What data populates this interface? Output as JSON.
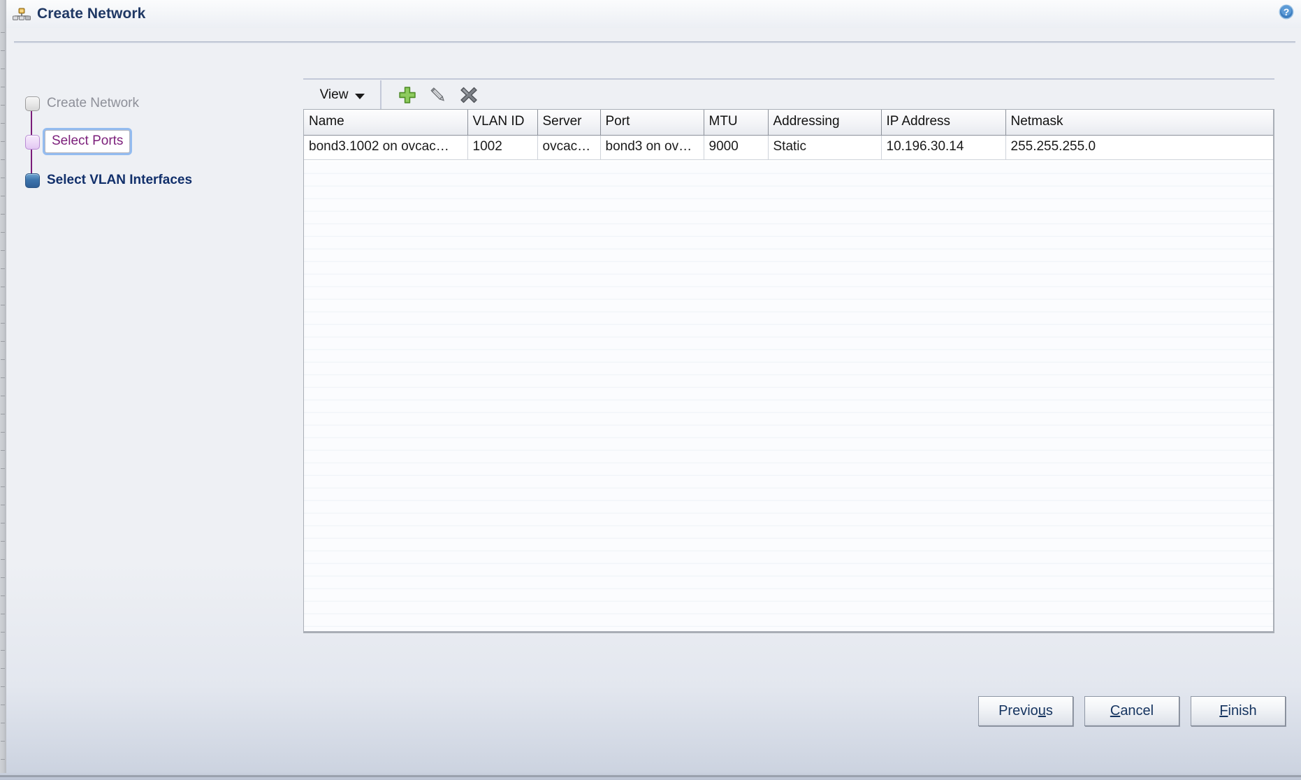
{
  "window": {
    "title": "Create Network",
    "title_icon": "network-create-icon",
    "help_icon": "help-question-icon"
  },
  "steps": [
    {
      "label": "Create Network",
      "state": "done",
      "icon": "step-box-done-icon"
    },
    {
      "label": "Select Ports",
      "state": "current",
      "icon": "step-box-current-icon"
    },
    {
      "label": "Select VLAN Interfaces",
      "state": "next",
      "icon": "step-box-next-icon"
    }
  ],
  "toolbar": {
    "view_label": "View",
    "caret_icon": "chevron-down-icon",
    "actions": [
      {
        "name": "add-icon",
        "label": "Add"
      },
      {
        "name": "edit-icon",
        "label": "Edit"
      },
      {
        "name": "delete-icon",
        "label": "Delete"
      }
    ]
  },
  "table": {
    "columns": [
      "Name",
      "VLAN ID",
      "Server",
      "Port",
      "MTU",
      "Addressing",
      "IP Address",
      "Netmask"
    ],
    "rows": [
      {
        "Name": "bond3.1002 on ovcac…",
        "VLAN ID": "1002",
        "Server": "ovcac…",
        "Port": "bond3 on ov…",
        "MTU": "9000",
        "Addressing": "Static",
        "IP Address": "10.196.30.14",
        "Netmask": "255.255.255.0"
      }
    ]
  },
  "footer": {
    "buttons": [
      {
        "name": "previous-button",
        "pre": "Previo",
        "mnemonic": "u",
        "post": "s"
      },
      {
        "name": "cancel-button",
        "pre": "",
        "mnemonic": "C",
        "post": "ancel"
      },
      {
        "name": "finish-button",
        "pre": "",
        "mnemonic": "F",
        "post": "inish"
      }
    ]
  },
  "colors": {
    "title_text": "#1f3864",
    "current_step_text": "#7b1e7a",
    "next_step_text": "#12306b",
    "connector": "#7b1e7a",
    "focus_ring": "#94bcf0",
    "add_icon_green": "#6cbb3c",
    "delete_icon_gray": "#6f7377",
    "help_blue": "#3d7ec0"
  }
}
